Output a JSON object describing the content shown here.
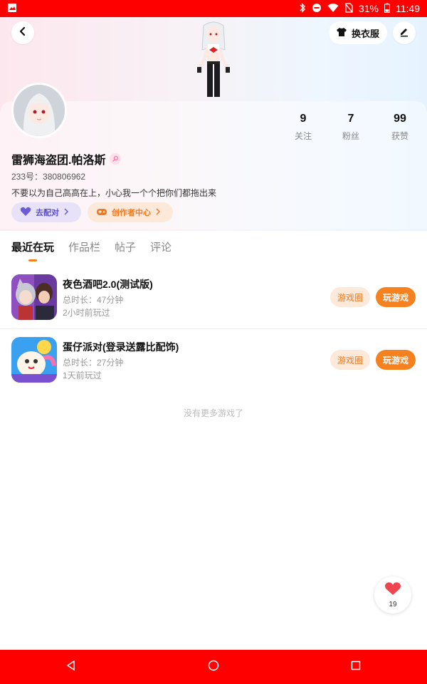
{
  "status_bar": {
    "battery": "31%",
    "time": "11:49"
  },
  "header": {
    "outfit_label": "换衣服"
  },
  "stats": [
    {
      "num": "9",
      "label": "关注"
    },
    {
      "num": "7",
      "label": "粉丝"
    },
    {
      "num": "99",
      "label": "获赞"
    }
  ],
  "profile": {
    "username": "雷狮海盗团.帕洛斯",
    "uid": "233号：380806962",
    "bio": "不要以为自己高高在上，小心我一个个把你们都拖出来"
  },
  "chips": {
    "match": "去配对",
    "creator": "创作者中心"
  },
  "tabs": [
    "最近在玩",
    "作品栏",
    "帖子",
    "评论"
  ],
  "games": [
    {
      "title": "夜色酒吧2.0(测试版)",
      "duration": "总时长：47分钟",
      "last_played": "2小时前玩过",
      "circle_btn": "游戏圈",
      "play_btn": "玩游戏"
    },
    {
      "title": "蛋仔派对(登录送露比配饰)",
      "duration": "总时长：27分钟",
      "last_played": "1天前玩过",
      "circle_btn": "游戏圈",
      "play_btn": "玩游戏"
    }
  ],
  "no_more": "没有更多游戏了",
  "like_count": "19",
  "colors": {
    "accent": "#f5821f",
    "status_bar": "#ff0000",
    "chip_purple": "#5b4cc9"
  }
}
